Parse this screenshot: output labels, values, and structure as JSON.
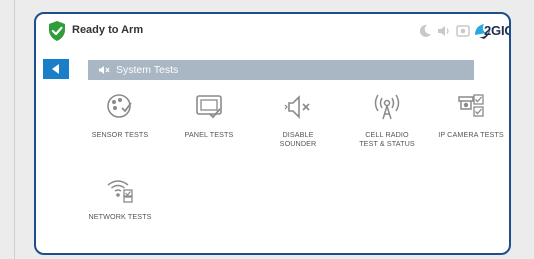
{
  "status": {
    "text": "Ready to Arm",
    "brand": "2GIG",
    "icons": [
      "moon-icon",
      "speaker-icon",
      "camera-icon"
    ]
  },
  "header": {
    "title": "System Tests"
  },
  "tiles": [
    {
      "label": "SENSOR TESTS",
      "icon": "sensor-icon"
    },
    {
      "label": "PANEL TESTS",
      "icon": "panel-icon"
    },
    {
      "label": "DISABLE\nSOUNDER",
      "icon": "mute-speaker-icon"
    },
    {
      "label": "CELL RADIO\nTEST & STATUS",
      "icon": "cell-radio-icon"
    },
    {
      "label": "IP CAMERA TESTS",
      "icon": "ip-camera-icon"
    },
    {
      "label": "NETWORK TESTS",
      "icon": "network-icon"
    }
  ],
  "colors": {
    "accent": "#1a7ec8",
    "frame": "#1f4e8c",
    "ready": "#2e9d3a",
    "title_bar": "#a9b6c3",
    "icon": "#8a8a8a"
  }
}
